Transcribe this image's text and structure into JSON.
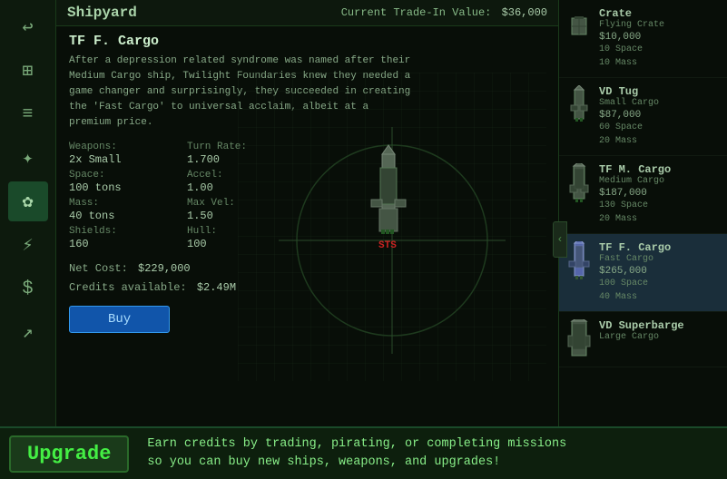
{
  "header": {
    "title": "Shipyard",
    "trade_in_label": "Current Trade-In Value:",
    "trade_in_value": "$36,000"
  },
  "ship": {
    "name": "TF F. Cargo",
    "description": "After a depression related syndrome was named after their Medium Cargo ship, Twilight Foundaries knew they needed a game changer and surprisingly, they succeeded in creating the 'Fast Cargo' to universal acclaim, albeit at a premium price.",
    "weapons_label": "Weapons:",
    "weapons_value": "2x Small",
    "turn_rate_label": "Turn Rate:",
    "turn_rate_value": "1.700",
    "space_label": "Space:",
    "space_value": "100 tons",
    "accel_label": "Accel:",
    "accel_value": "1.00",
    "mass_label": "Mass:",
    "mass_value": "40 tons",
    "max_vel_label": "Max Vel:",
    "max_vel_value": "1.50",
    "shields_label": "Shields:",
    "shields_value": "160",
    "hull_label": "Hull:",
    "hull_value": "100",
    "net_cost_label": "Net Cost:",
    "net_cost_value": "$229,000",
    "credits_label": "Credits available:",
    "credits_value": "$2.49M",
    "buy_label": "Buy",
    "sts": "STS"
  },
  "ship_list": [
    {
      "name": "Crate",
      "type": "Flying Crate",
      "price": "$10,000",
      "stats": "10 Space\n10 Mass",
      "selected": false,
      "icon": "▣"
    },
    {
      "name": "VD Tug",
      "type": "Small Cargo",
      "price": "$87,000",
      "stats": "60 Space\n20 Mass",
      "selected": false,
      "icon": "▣"
    },
    {
      "name": "TF M. Cargo",
      "type": "Medium Cargo",
      "price": "$187,000",
      "stats": "130 Space\n20 Mass",
      "selected": false,
      "icon": "▣"
    },
    {
      "name": "TF F. Cargo",
      "type": "Fast Cargo",
      "price": "$265,000",
      "stats": "100 Space\n40 Mass",
      "selected": true,
      "icon": "▣"
    },
    {
      "name": "VD Superbarge",
      "type": "Large Cargo",
      "price": "",
      "stats": "",
      "selected": false,
      "icon": "▣"
    }
  ],
  "sidebar": {
    "icons": [
      {
        "name": "back-icon",
        "symbol": "↩",
        "active": false
      },
      {
        "name": "map-icon",
        "symbol": "⊞",
        "active": false
      },
      {
        "name": "cargo-icon",
        "symbol": "≡",
        "active": false
      },
      {
        "name": "tools-icon",
        "symbol": "✦",
        "active": false
      },
      {
        "name": "helm-icon",
        "symbol": "✿",
        "active": true
      },
      {
        "name": "trade-icon",
        "symbol": "⚡",
        "active": false
      },
      {
        "name": "money-icon",
        "symbol": "$",
        "active": false
      },
      {
        "name": "stats-icon",
        "symbol": "↗",
        "active": false
      }
    ]
  },
  "bottom": {
    "upgrade_label": "Upgrade",
    "tip_line1": "Earn credits by trading, pirating, or completing missions",
    "tip_line2": "so you can buy new ships, weapons, and upgrades!"
  },
  "collapse_arrow": "‹"
}
